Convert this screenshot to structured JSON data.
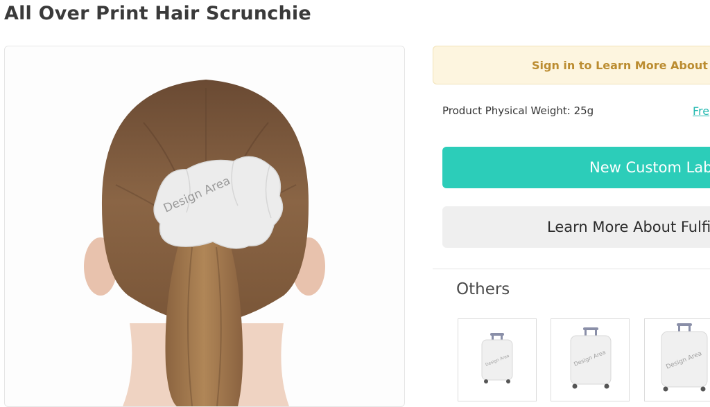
{
  "product": {
    "title": "All Over Print Hair Scrunchie",
    "design_area_label": "Design Area"
  },
  "sidebar": {
    "signin_text": "Sign in to Learn More About P",
    "weight_text": "Product Physical Weight: 25g",
    "free_link": "Fre",
    "primary_button": "New Custom Lab",
    "secondary_button": "Learn More About Fulfil",
    "others_heading": "Others"
  },
  "others": {
    "items": [
      {
        "design_label": "Design Area"
      },
      {
        "design_label": "Design Area"
      },
      {
        "design_label": "Design Area"
      }
    ]
  },
  "colors": {
    "accent": "#2ccdb9",
    "signin_bg": "#fdf5df",
    "signin_text": "#bb8c30"
  }
}
